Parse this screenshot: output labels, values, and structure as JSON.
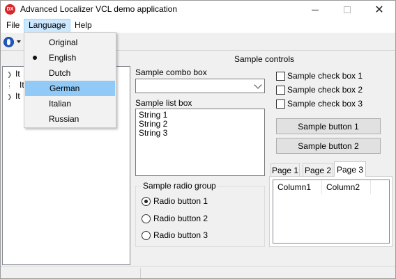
{
  "window": {
    "title": "Advanced Localizer VCL demo application",
    "app_icon_text": "DX",
    "close_glyph": "✕"
  },
  "menubar": {
    "file": "File",
    "language": "Language",
    "help": "Help"
  },
  "language_menu": {
    "items": [
      {
        "label": "Original",
        "selected": false,
        "highlighted": false
      },
      {
        "label": "English",
        "selected": true,
        "highlighted": false
      },
      {
        "label": "Dutch",
        "selected": false,
        "highlighted": false
      },
      {
        "label": "German",
        "selected": false,
        "highlighted": true
      },
      {
        "label": "Italian",
        "selected": false,
        "highlighted": false
      },
      {
        "label": "Russian",
        "selected": false,
        "highlighted": false
      }
    ]
  },
  "tree": {
    "items": [
      "It",
      "It",
      "It"
    ]
  },
  "sample": {
    "title": "Sample controls",
    "combo_label": "Sample combo box",
    "combo_value": "",
    "list_label": "Sample list box",
    "list_items": [
      "String 1",
      "String 2",
      "String 3"
    ],
    "radio_group_title": "Sample radio group",
    "radios": [
      {
        "label": "Radio button 1",
        "checked": true
      },
      {
        "label": "Radio button 2",
        "checked": false
      },
      {
        "label": "Radio button 3",
        "checked": false
      }
    ],
    "checkboxes": [
      {
        "label": "Sample check box 1",
        "checked": false
      },
      {
        "label": "Sample check box 2",
        "checked": false
      },
      {
        "label": "Sample check box 3",
        "checked": false
      }
    ],
    "button1": "Sample button 1",
    "button2": "Sample button 2",
    "tabs": [
      "Page 1",
      "Page 2",
      "Page 3"
    ],
    "active_tab": "Page 3",
    "columns": [
      "Column1",
      "Column2"
    ]
  },
  "colors": {
    "menu_highlight": "#91c9f7",
    "menubar_active": "#cce8ff",
    "app_icon": "#d9262b",
    "globe": "#2158c4"
  }
}
